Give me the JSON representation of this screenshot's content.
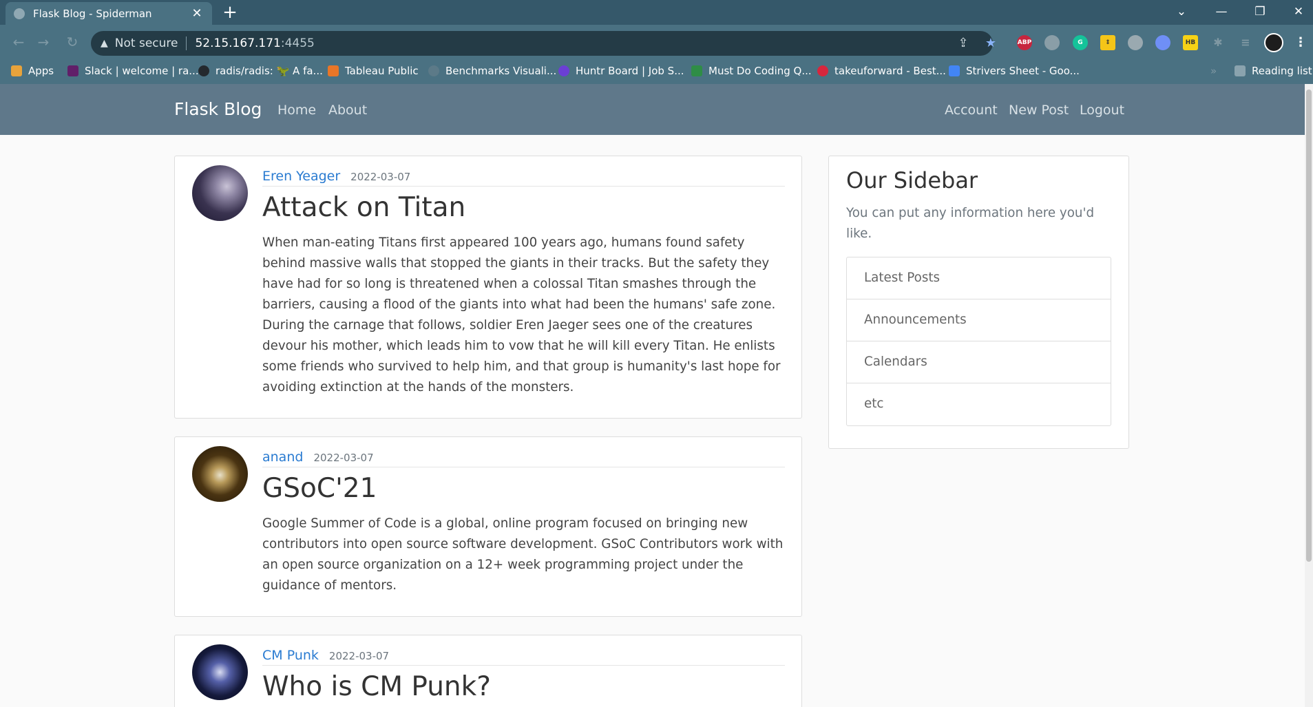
{
  "browser": {
    "tab_title": "Flask Blog - Spiderman",
    "not_secure": "Not secure",
    "url_host": "52.15.167.171",
    "url_port": ":4455",
    "extensions": [
      "ABP",
      "G",
      "HB"
    ],
    "bookmarks": [
      {
        "label": "Apps",
        "color": "#e8a33b"
      },
      {
        "label": "Slack | welcome | ra...",
        "color": "#611f69"
      },
      {
        "label": "radis/radis: 🦖 A fa...",
        "color": "#24292e"
      },
      {
        "label": "Tableau Public",
        "color": "#e97627"
      },
      {
        "label": "Benchmarks Visuali...",
        "color": "#5c7a88"
      },
      {
        "label": "Huntr Board | Job S...",
        "color": "#6b3fd4"
      },
      {
        "label": "Must Do Coding Q...",
        "color": "#2f8d46"
      },
      {
        "label": "takeuforward - Best...",
        "color": "#d7263d"
      },
      {
        "label": "Strivers Sheet - Goo...",
        "color": "#4285f4"
      },
      {
        "label": "Reading list",
        "color": "#8aa3ae"
      }
    ]
  },
  "site": {
    "brand": "Flask Blog",
    "nav_left": [
      "Home",
      "About"
    ],
    "nav_right": [
      "Account",
      "New Post",
      "Logout"
    ]
  },
  "posts": [
    {
      "author": "Eren Yeager",
      "date": "2022-03-07",
      "title": "Attack on Titan",
      "body": "When man-eating Titans first appeared 100 years ago, humans found safety behind massive walls that stopped the giants in their tracks. But the safety they have had for so long is threatened when a colossal Titan smashes through the barriers, causing a flood of the giants into what had been the humans' safe zone. During the carnage that follows, soldier Eren Jaeger sees one of the creatures devour his mother, which leads him to vow that he will kill every Titan. He enlists some friends who survived to help him, and that group is humanity's last hope for avoiding extinction at the hands of the monsters."
    },
    {
      "author": "anand",
      "date": "2022-03-07",
      "title": "GSoC'21",
      "body": "Google Summer of Code is a global, online program focused on bringing new contributors into open source software development. GSoC Contributors work with an open source organization on a 12+ week programming project under the guidance of mentors."
    },
    {
      "author": "CM Punk",
      "date": "2022-03-07",
      "title": "Who is CM Punk?",
      "body": ""
    }
  ],
  "sidebar": {
    "title": "Our Sidebar",
    "text": "You can put any information here you'd like.",
    "items": [
      "Latest Posts",
      "Announcements",
      "Calendars",
      "etc"
    ]
  }
}
